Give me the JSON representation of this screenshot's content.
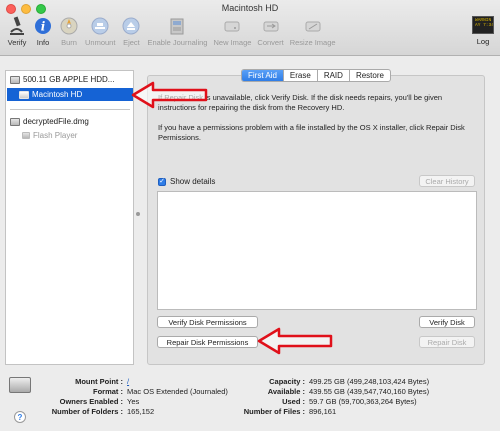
{
  "window": {
    "title": "Macintosh HD"
  },
  "toolbar": {
    "items": [
      {
        "label": "Verify",
        "icon": "microscope-icon",
        "enabled": true
      },
      {
        "label": "Info",
        "icon": "info-icon",
        "enabled": true
      },
      {
        "label": "Burn",
        "icon": "burn-disc-icon",
        "enabled": false
      },
      {
        "label": "Unmount",
        "icon": "unmount-icon",
        "enabled": false
      },
      {
        "label": "Eject",
        "icon": "eject-icon",
        "enabled": false
      },
      {
        "label": "Enable Journaling",
        "icon": "journal-icon",
        "enabled": false
      },
      {
        "label": "New Image",
        "icon": "new-image-icon",
        "enabled": false
      },
      {
        "label": "Convert",
        "icon": "convert-icon",
        "enabled": false
      },
      {
        "label": "Resize Image",
        "icon": "resize-image-icon",
        "enabled": false
      }
    ],
    "log": {
      "label": "Log",
      "screen_text": "WARNIN\nAY 7:34"
    }
  },
  "sidebar": {
    "disk": "500.11 GB APPLE HDD...",
    "volume": "Macintosh HD",
    "image": "decryptedFile.dmg",
    "image_volume": "Flash Player"
  },
  "tabs": [
    "First Aid",
    "Erase",
    "RAID",
    "Restore"
  ],
  "first_aid": {
    "para1": "If Repair Disk is unavailable, click Verify Disk. If the disk needs repairs, you'll be given instructions for repairing the disk from the Recovery HD.",
    "para2": "If you have a permissions problem with a file installed by the OS X installer, click Repair Disk Permissions.",
    "show_details": "Show details",
    "clear_history": "Clear History",
    "verify_permissions": "Verify Disk Permissions",
    "verify_disk": "Verify Disk",
    "repair_permissions": "Repair Disk Permissions",
    "repair_disk": "Repair Disk"
  },
  "info": {
    "mount_point_label": "Mount Point :",
    "mount_point": "/",
    "format_label": "Format :",
    "format": "Mac OS Extended (Journaled)",
    "owners_label": "Owners Enabled :",
    "owners": "Yes",
    "folders_label": "Number of Folders :",
    "folders": "165,152",
    "capacity_label": "Capacity :",
    "capacity": "499.25 GB (499,248,103,424 Bytes)",
    "available_label": "Available :",
    "available": "439.55 GB (439,547,740,160 Bytes)",
    "used_label": "Used :",
    "used": "59.7 GB (59,700,363,264 Bytes)",
    "files_label": "Number of Files :",
    "files": "896,161"
  },
  "colors": {
    "selection": "#1563d5",
    "tab_active": "#2f7de7",
    "annotation_arrow": "#e0101a"
  }
}
